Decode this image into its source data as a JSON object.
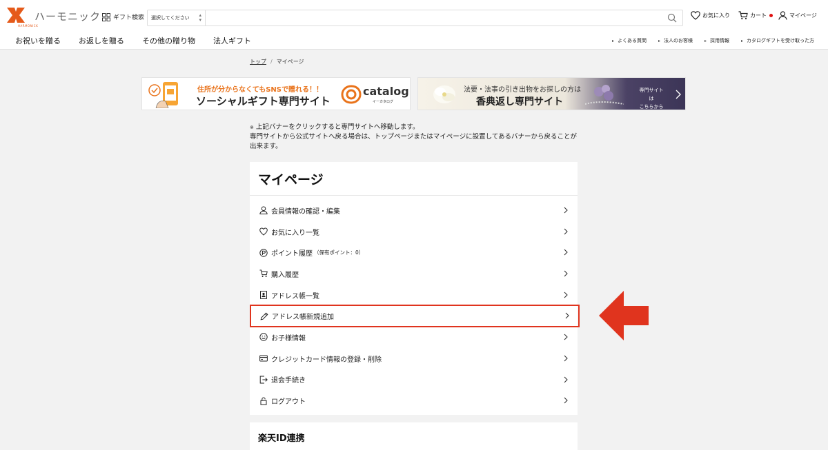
{
  "header": {
    "logo_text": "ハーモニック",
    "logo_sub": "HARMONICK",
    "gift_search_label": "ギフト検索",
    "search": {
      "select_value": "選択してください",
      "placeholder": ""
    },
    "utility": {
      "favorites": "お気に入り",
      "cart": "カート",
      "mypage": "マイページ"
    },
    "nav": [
      "お祝いを贈る",
      "お返しを贈る",
      "その他の贈り物",
      "法人ギフト"
    ],
    "subnav": [
      "よくある質問",
      "法人のお客様",
      "採用情報",
      "カタログギフトを受け取った方"
    ]
  },
  "breadcrumb": {
    "top": "トップ",
    "current": "マイページ"
  },
  "banners": {
    "social": {
      "line1": "住所が分からなくてもSNSで贈れる！！",
      "line2": "ソーシャルギフト専門サイト",
      "brand": "catalog",
      "brand_sub": "イーカタログ"
    },
    "koden": {
      "line1": "法要・法事の引き出物をお探しの方は",
      "line2": "香典返し専門サイト",
      "side1": "専門サイトは",
      "side2": "こちらから"
    }
  },
  "note": {
    "asterisk": "※",
    "line1": "上記バナーをクリックすると専門サイトへ移動します。",
    "line2": "専門サイトから公式サイトへ戻る場合は、トップページまたはマイページに設置してあるバナーから戻ることが出来ます。"
  },
  "mypage": {
    "title": "マイページ",
    "items": [
      {
        "label": "会員情報の確認・編集",
        "icon": "user-icon"
      },
      {
        "label": "お気に入り一覧",
        "icon": "heart-icon"
      },
      {
        "label": "ポイント履歴",
        "sub": "（保有ポイント：0）",
        "icon": "point-icon"
      },
      {
        "label": "購入履歴",
        "icon": "cart-icon"
      },
      {
        "label": "アドレス帳一覧",
        "icon": "address-book-icon"
      },
      {
        "label": "アドレス帳新規追加",
        "icon": "pencil-icon"
      },
      {
        "label": "お子様情報",
        "icon": "smile-icon"
      },
      {
        "label": "クレジットカード情報の登録・削除",
        "icon": "credit-card-icon"
      },
      {
        "label": "退会手続き",
        "icon": "exit-icon"
      },
      {
        "label": "ログアウト",
        "icon": "lock-icon"
      }
    ]
  },
  "rakuten": {
    "title": "楽天ID連携"
  },
  "colors": {
    "brand": "#e55a1a",
    "highlight": "#e0341e",
    "cart_dot": "#e01010"
  }
}
